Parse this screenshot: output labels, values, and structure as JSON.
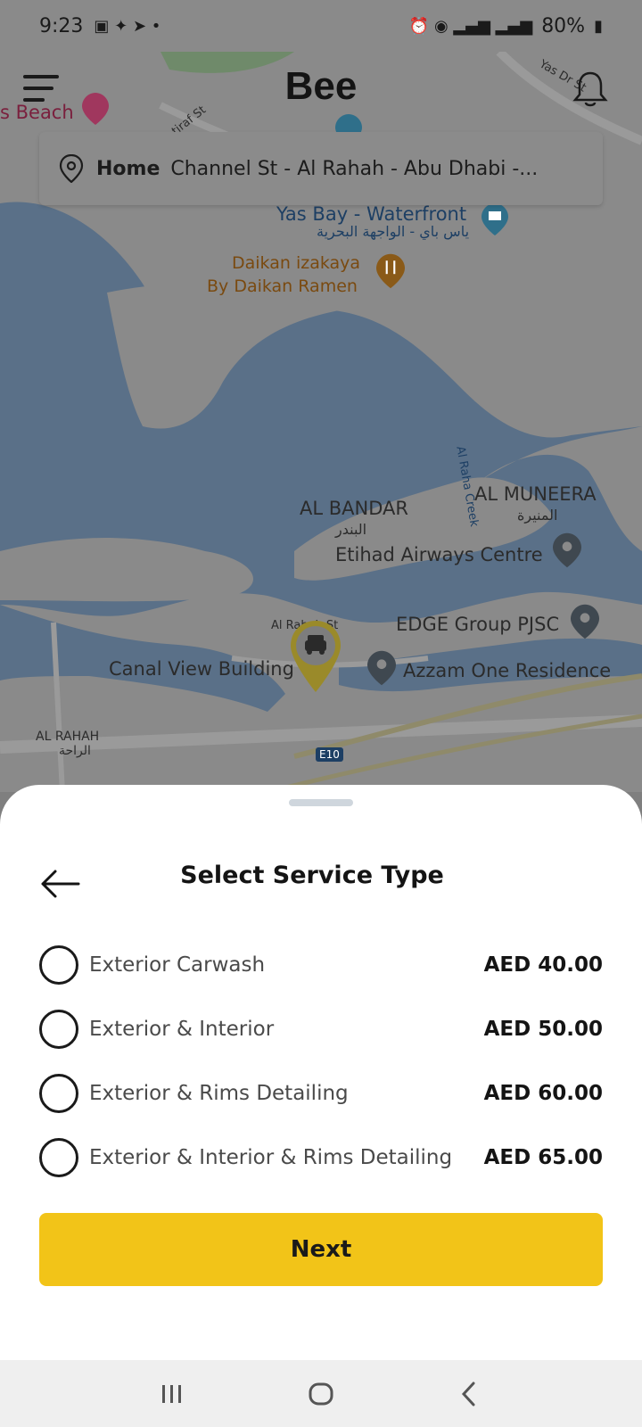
{
  "status_bar": {
    "time": "9:23",
    "battery": "80%"
  },
  "app": {
    "title": "Bee"
  },
  "location": {
    "label": "Home",
    "address": "Channel St - Al Rahah - Abu Dhabi -..."
  },
  "map": {
    "places": {
      "beach": "s Beach",
      "yas_bay": "Yas Bay - Waterfront",
      "yas_bay_ar": "ياس باي - الواجهة البحرية",
      "daikan_1": "Daikan izakaya",
      "daikan_2": "By Daikan Ramen",
      "al_bandar": "AL BANDAR",
      "al_bandar_ar": "البندر",
      "al_muneera": "AL MUNEERA",
      "al_muneera_ar": "المنيرة",
      "etihad": "Etihad Airways Centre",
      "edge": "EDGE Group PJSC",
      "canal_view": "Canal View Building",
      "azzam": "Azzam One Residence",
      "al_rahah": "AL RAHAH",
      "al_rahah_ar": "الراحة",
      "al_rahah_st": "Al Rahah St",
      "al_raha_creek": "Al Raha Creek",
      "street_top": "Yas Dr St",
      "street_2": "tiraf St",
      "road_code": "E10"
    }
  },
  "sheet": {
    "title": "Select Service Type",
    "options": [
      {
        "label": "Exterior Carwash",
        "price": "AED 40.00"
      },
      {
        "label": "Exterior & Interior",
        "price": "AED 50.00"
      },
      {
        "label": "Exterior & Rims Detailing",
        "price": "AED 60.00"
      },
      {
        "label": "Exterior & Interior & Rims Detailing",
        "price": "AED 65.00"
      }
    ],
    "next_label": "Next"
  },
  "colors": {
    "accent": "#f2c418",
    "water": "#5a7088",
    "land": "#8a8a8a"
  }
}
